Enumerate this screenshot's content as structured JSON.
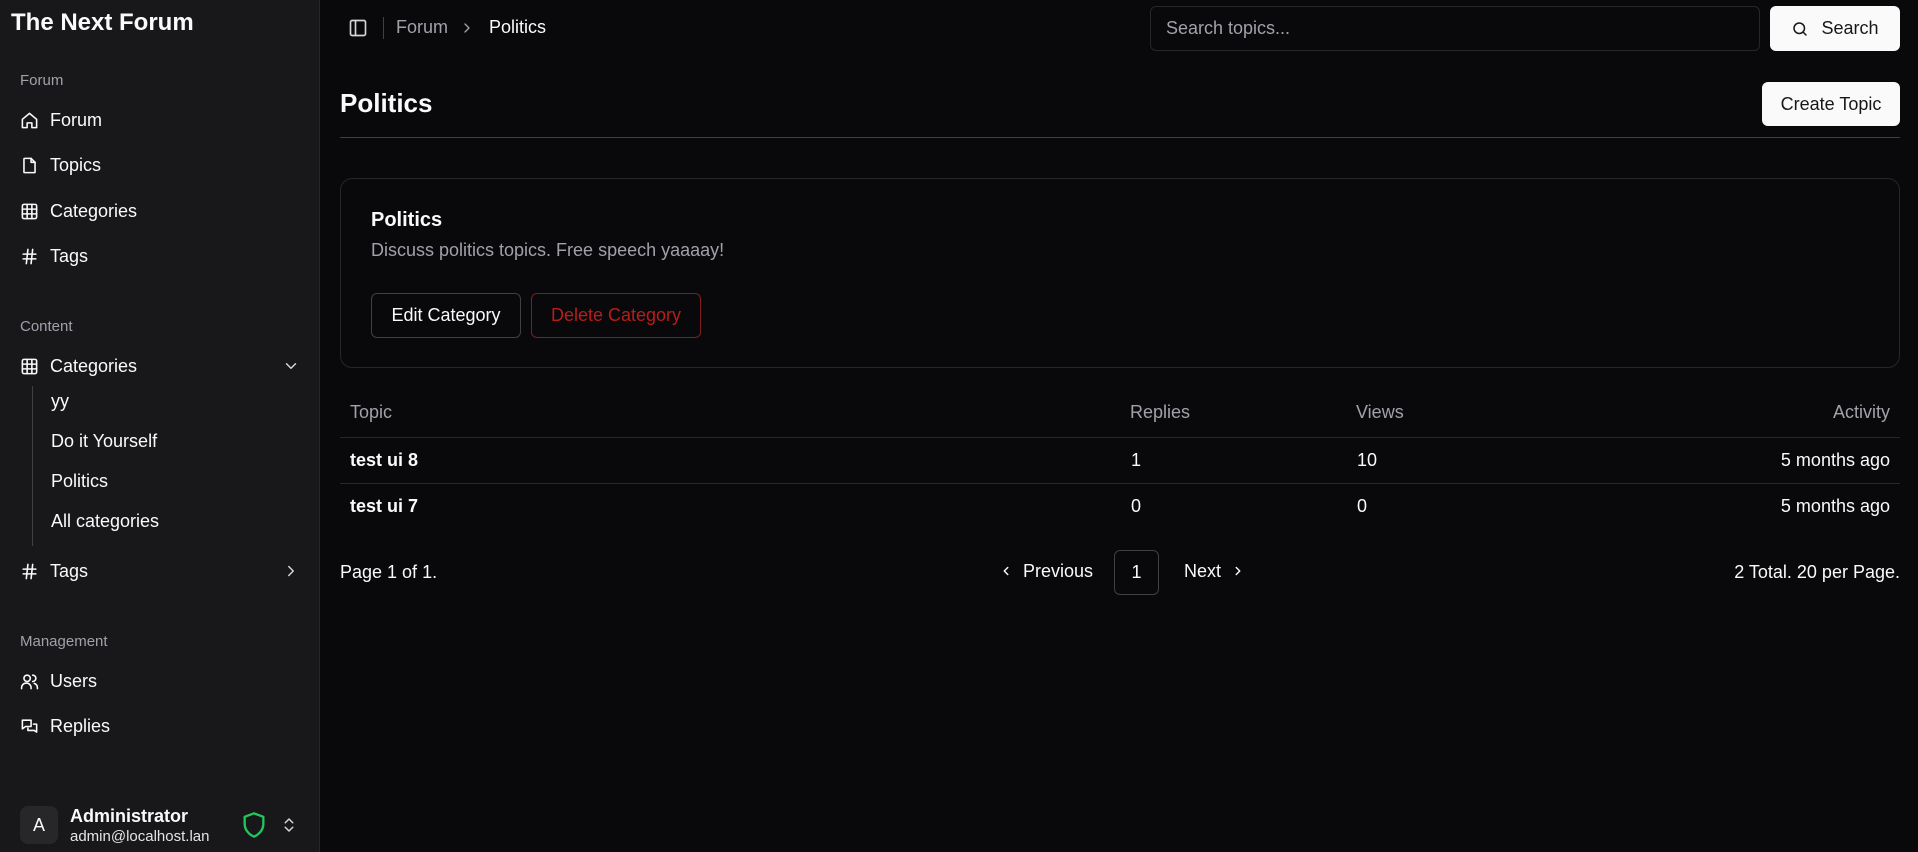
{
  "sidebar": {
    "brand": "The Next Forum",
    "groups": {
      "forum": "Forum",
      "content": "Content",
      "management": "Management"
    },
    "forum_items": [
      {
        "label": "Forum",
        "icon": "home-icon"
      },
      {
        "label": "Topics",
        "icon": "file-icon"
      },
      {
        "label": "Categories",
        "icon": "grid-icon"
      },
      {
        "label": "Tags",
        "icon": "hash-icon"
      }
    ],
    "content_items": {
      "categories": {
        "label": "Categories",
        "icon": "grid-icon",
        "expanded": true
      },
      "sub_categories": [
        "yy",
        "Do it Yourself",
        "Politics",
        "All categories"
      ],
      "tags": {
        "label": "Tags",
        "icon": "hash-icon",
        "expanded": false
      }
    },
    "management_items": [
      {
        "label": "Users",
        "icon": "users-icon"
      },
      {
        "label": "Replies",
        "icon": "messages-icon"
      }
    ],
    "user": {
      "initial": "A",
      "name": "Administrator",
      "email": "admin@localhost.lan",
      "badge_icon": "shield-icon",
      "badge_color": "#22c55e"
    }
  },
  "topbar": {
    "breadcrumb": [
      "Forum",
      "Politics"
    ],
    "search_placeholder": "Search topics...",
    "search_label": "Search"
  },
  "page": {
    "title": "Politics",
    "create_label": "Create Topic"
  },
  "category": {
    "name": "Politics",
    "description": "Discuss politics topics. Free speech yaaaay!",
    "edit_label": "Edit Category",
    "delete_label": "Delete Category"
  },
  "table": {
    "headers": {
      "topic": "Topic",
      "replies": "Replies",
      "views": "Views",
      "activity": "Activity"
    },
    "rows": [
      {
        "topic": "test ui 8",
        "replies": "1",
        "views": "10",
        "activity": "5 months ago"
      },
      {
        "topic": "test ui 7",
        "replies": "0",
        "views": "0",
        "activity": "5 months ago"
      }
    ]
  },
  "pagination": {
    "page_info": "Page 1 of 1.",
    "previous_label": "Previous",
    "current_page": "1",
    "next_label": "Next",
    "total_info": "2 Total. 20 per Page."
  },
  "colors": {
    "background": "#09090b",
    "sidebar": "#18181b",
    "danger": "#b91c1c",
    "success": "#22c55e"
  }
}
